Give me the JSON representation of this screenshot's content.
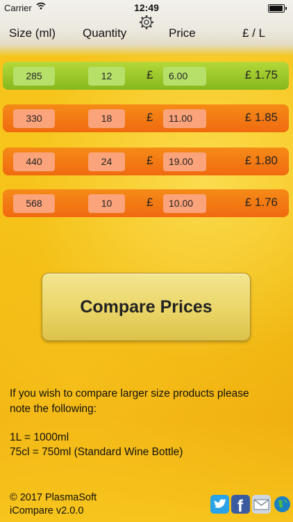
{
  "status_bar": {
    "carrier": "Carrier",
    "time": "12:49"
  },
  "headers": {
    "size": "Size (ml)",
    "quantity": "Quantity",
    "price": "Price",
    "per_litre": "£ / L"
  },
  "rows": [
    {
      "size": "285",
      "quantity": "12",
      "currency": "£",
      "price": "6.00",
      "per_litre": "£ 1.75",
      "highlight": "green"
    },
    {
      "size": "330",
      "quantity": "18",
      "currency": "£",
      "price": "11.00",
      "per_litre": "£ 1.85",
      "highlight": "orange"
    },
    {
      "size": "440",
      "quantity": "24",
      "currency": "£",
      "price": "19.00",
      "per_litre": "£ 1.80",
      "highlight": "orange"
    },
    {
      "size": "568",
      "quantity": "10",
      "currency": "£",
      "price": "10.00",
      "per_litre": "£ 1.76",
      "highlight": "orange"
    }
  ],
  "compare_button": "Compare Prices",
  "info": {
    "line1": "If you wish to compare larger size products please",
    "line2": "note the following:",
    "line3": "1L = 1000ml",
    "line4": "75cl = 750ml (Standard Wine Bottle)"
  },
  "footer": {
    "copyright": "© 2017 PlasmaSoft",
    "version": "iCompare v2.0.0"
  },
  "icons": [
    "gear-icon",
    "twitter-icon",
    "facebook-icon",
    "mail-icon",
    "web-icon"
  ],
  "colors": {
    "best_row": "#8fbe22",
    "other_row": "#f27a12",
    "button": "#ead567"
  }
}
